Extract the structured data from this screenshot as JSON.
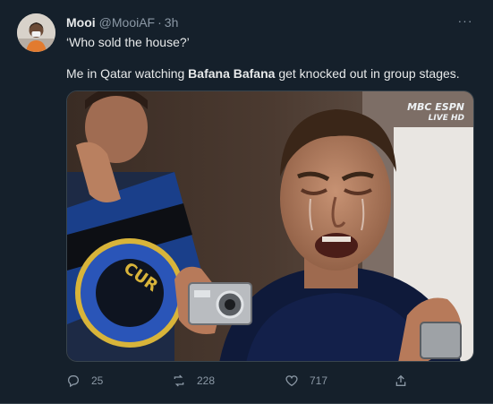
{
  "tweet": {
    "display_name": "Mooi",
    "handle": "@MooiAF",
    "separator": "·",
    "time": "3h",
    "more_label": "···",
    "line1": "‘Who sold the house?’",
    "line2_prefix": "Me in Qatar watching ",
    "line2_bold": "Bafana Bafana",
    "line2_suffix": " get knocked out in group stages.",
    "media": {
      "watermark_logo": "MBC ESPN",
      "watermark_live": "LIVE HD"
    }
  },
  "actions": {
    "reply_count": "25",
    "retweet_count": "228",
    "like_count": "717"
  },
  "icons": [
    "reply-icon",
    "retweet-icon",
    "like-icon",
    "share-icon",
    "more-icon"
  ],
  "colors": {
    "background": "#15202b",
    "text": "#e7e9ea",
    "muted": "#8b98a5",
    "border": "#38444d"
  }
}
